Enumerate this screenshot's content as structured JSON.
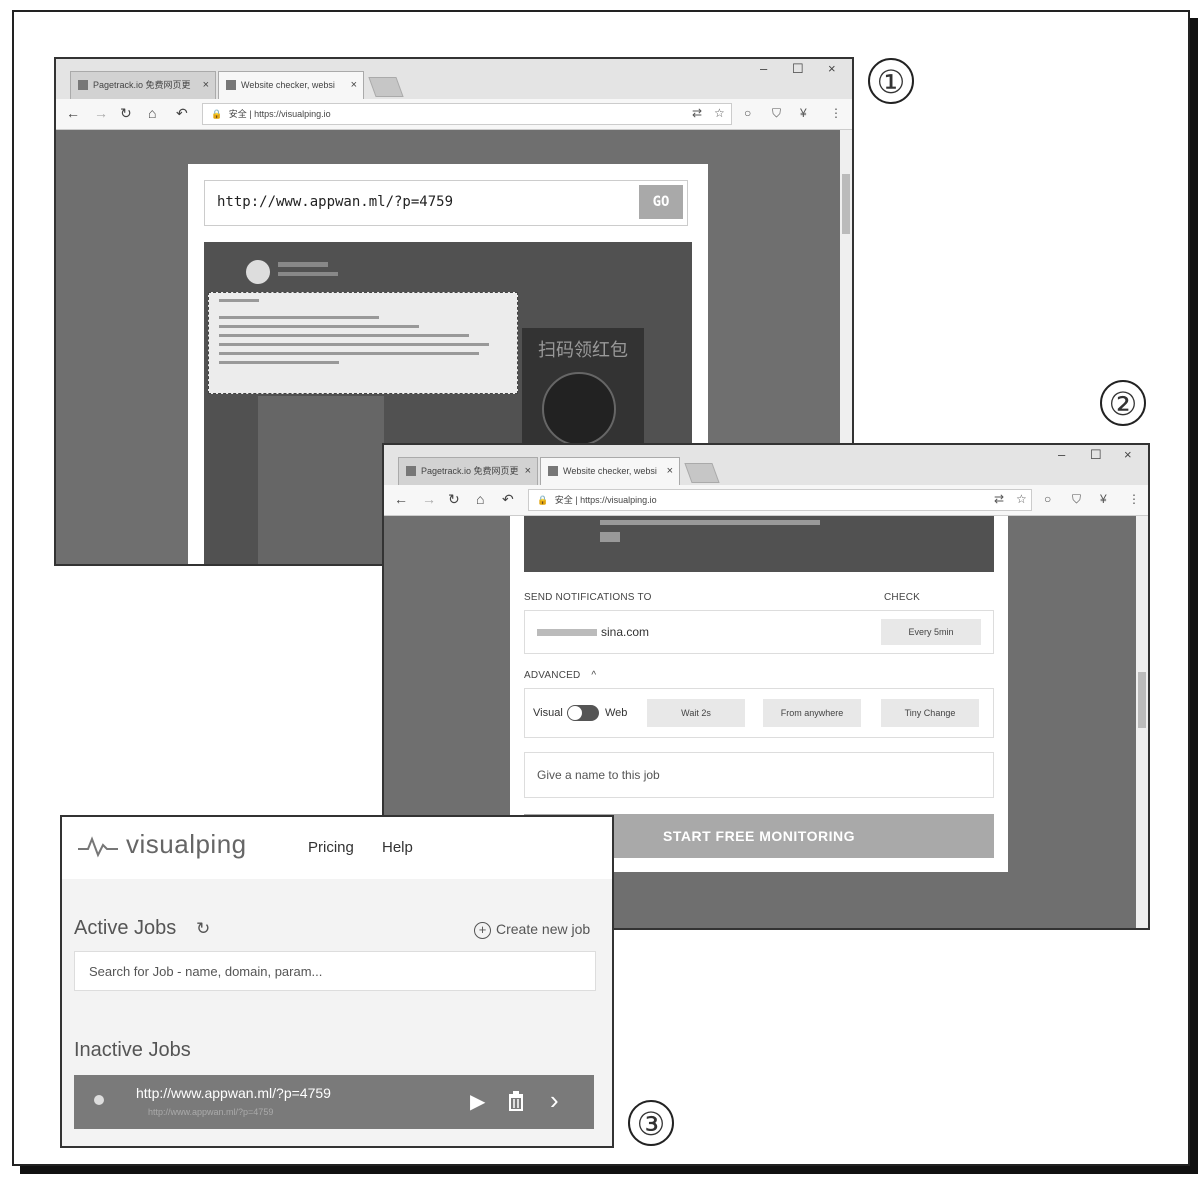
{
  "markers": {
    "one": "①",
    "two": "②",
    "three": "③"
  },
  "browser1": {
    "tabs": [
      {
        "label": "Pagetrack.io 免费网页更",
        "close": "×"
      },
      {
        "label": "Website checker, websi",
        "close": "×"
      }
    ],
    "window_controls": {
      "minimize": "–",
      "maximize": "☐",
      "close": "×"
    },
    "address": {
      "lock": "🔒",
      "secure": "安全",
      "url": "https://visualping.io"
    },
    "url_input": "http://www.appwan.ml/?p=4759",
    "go_label": "GO",
    "preview_promo": "扫码领红包"
  },
  "browser2": {
    "tabs": [
      {
        "label": "Pagetrack.io 免费网页更",
        "close": "×"
      },
      {
        "label": "Website checker, websi",
        "close": "×"
      }
    ],
    "window_controls": {
      "minimize": "–",
      "maximize": "☐",
      "close": "×"
    },
    "address": {
      "lock": "🔒",
      "secure": "安全",
      "url": "https://visualping.io"
    },
    "send_notifications_label": "SEND NOTIFICATIONS TO",
    "check_label": "CHECK",
    "email_suffix": "sina.com",
    "check_frequency": "Every 5min",
    "advanced_label": "ADVANCED",
    "advanced_caret": "^",
    "toggle_left": "Visual",
    "toggle_right": "Web",
    "option_wait": "Wait 2s",
    "option_location": "From anywhere",
    "option_change": "Tiny Change",
    "job_name_placeholder": "Give a name to this job",
    "start_button": "START FREE MONITORING"
  },
  "app": {
    "logo_text": "visualping",
    "nav": [
      "Pricing",
      "Help"
    ],
    "active_jobs_title": "Active Jobs",
    "refresh_icon": "↻",
    "create_new_job": "Create new job",
    "search_placeholder": "Search for Job - name, domain, param...",
    "inactive_jobs_title": "Inactive Jobs",
    "job_url": "http://www.appwan.ml/?p=4759",
    "job_sub_url": "http://www.appwan.ml/?p=4759"
  }
}
